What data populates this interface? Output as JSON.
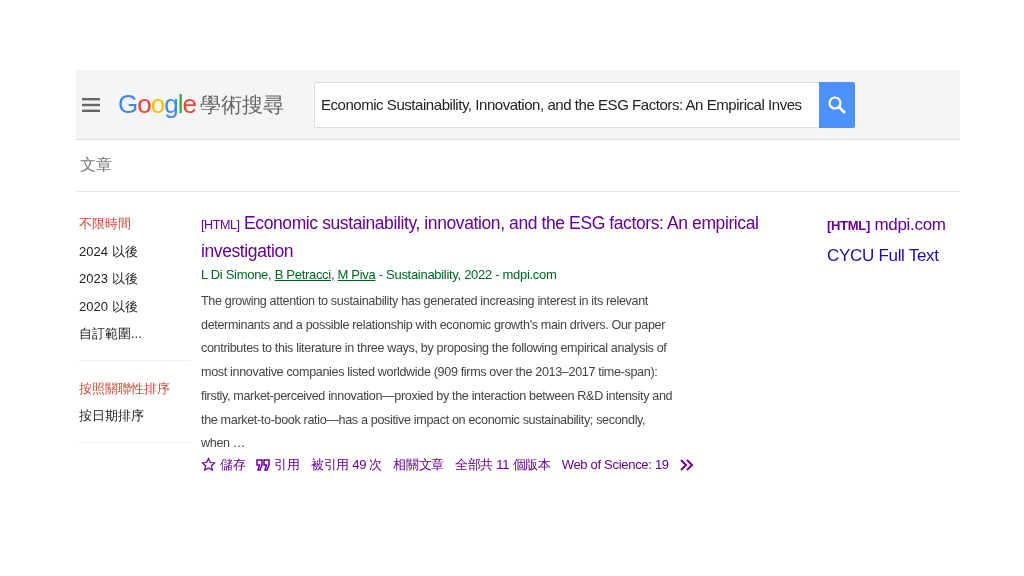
{
  "header": {
    "logo": "Google",
    "product": "學術搜尋",
    "search": {
      "value": "Economic Sustainability, Innovation, and the ESG Factors: An Empirical Inves"
    }
  },
  "section_title": "文章",
  "sidebar": {
    "groups": [
      {
        "items": [
          {
            "label": "不限時間",
            "selected": true
          },
          {
            "label": "2024 以後",
            "selected": false
          },
          {
            "label": "2023 以後",
            "selected": false
          },
          {
            "label": "2020 以後",
            "selected": false
          },
          {
            "label": "自訂範圍...",
            "selected": false
          }
        ]
      },
      {
        "items": [
          {
            "label": "按照關聯性排序",
            "selected": true
          },
          {
            "label": "按日期排序",
            "selected": false
          }
        ]
      }
    ]
  },
  "result": {
    "format": "[HTML]",
    "title": "Economic sustainability, innovation, and the ESG factors: An empirical investigation",
    "authors": [
      {
        "name": "L Di Simone,",
        "linked": false
      },
      {
        "name": "B Petracci,",
        "linked": true
      },
      {
        "name": "M Piva",
        "linked": true
      }
    ],
    "source": " - Sustainability, 2022 - mdpi.com",
    "snippet": "The growing attention to sustainability has generated increasing interest in its relevant determinants and a possible relationship with economic growth's main drivers. Our paper contributes to this literature in three ways, by proposing the following empirical analysis of most innovative companies listed worldwide (909 firms over the 2013–2017 time-span): firstly, market-perceived innovation—proxied by the interaction between R&D intensity and the market-to-book ratio—has a positive impact on economic sustainability; secondly, when …",
    "actions": [
      {
        "kind": "save",
        "label": "儲存"
      },
      {
        "kind": "cite",
        "label": "引用"
      },
      {
        "kind": "plain",
        "label": "被引用 49 次"
      },
      {
        "kind": "plain",
        "label": "相關文章"
      },
      {
        "kind": "plain",
        "label": "全部共 11 個版本"
      },
      {
        "kind": "plain",
        "label": "Web of Science: 19"
      },
      {
        "kind": "more"
      }
    ],
    "side_links": [
      {
        "format": "[HTML]",
        "label": "mdpi.com"
      },
      {
        "label": "CYCU Full Text"
      }
    ]
  }
}
